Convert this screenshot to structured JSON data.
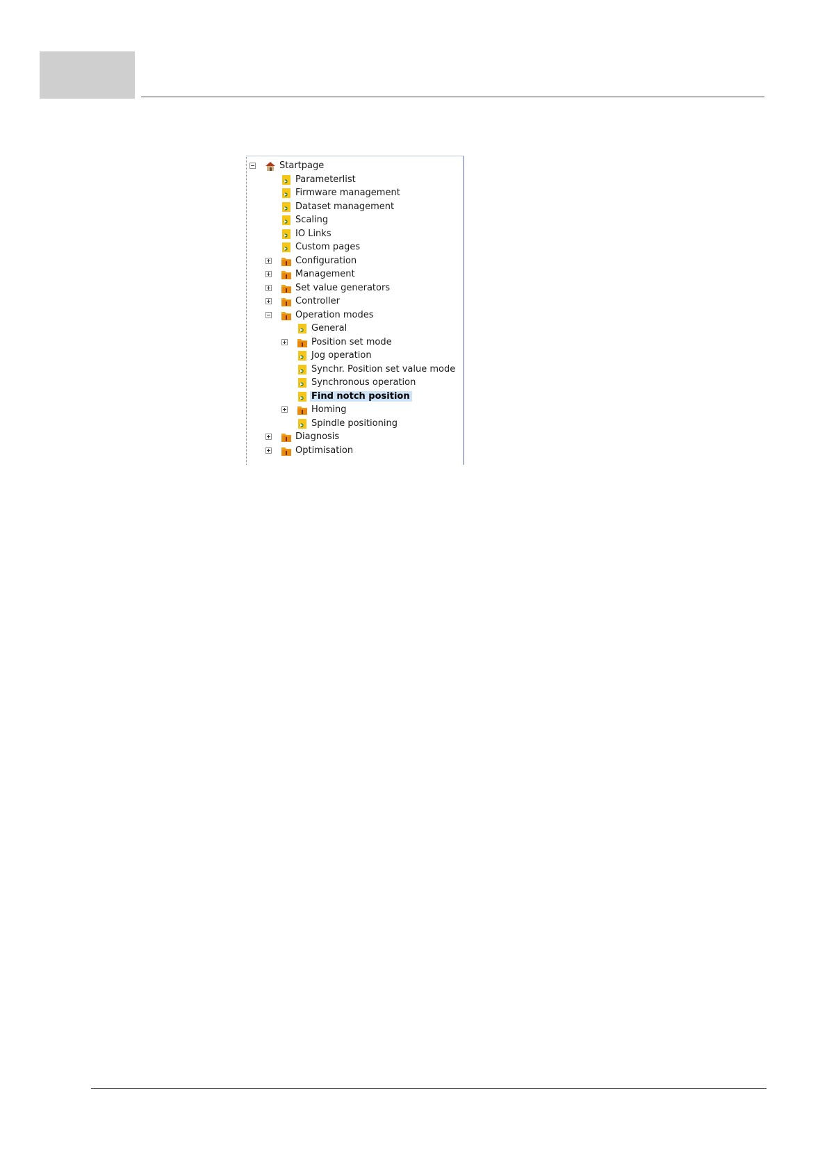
{
  "tree": {
    "root": {
      "label": "Startpage",
      "icon": "house-icon",
      "expanded": true
    },
    "items": [
      {
        "label": "Parameterlist",
        "icon": "page-icon",
        "level": 1,
        "toggle": "none"
      },
      {
        "label": "Firmware management",
        "icon": "page-icon",
        "level": 1,
        "toggle": "none"
      },
      {
        "label": "Dataset management",
        "icon": "page-icon",
        "level": 1,
        "toggle": "none"
      },
      {
        "label": "Scaling",
        "icon": "page-icon",
        "level": 1,
        "toggle": "none"
      },
      {
        "label": "IO Links",
        "icon": "page-icon",
        "level": 1,
        "toggle": "none"
      },
      {
        "label": "Custom pages",
        "icon": "page-icon",
        "level": 1,
        "toggle": "none"
      },
      {
        "label": "Configuration",
        "icon": "folder-icon",
        "level": 1,
        "toggle": "plus"
      },
      {
        "label": "Management",
        "icon": "folder-icon",
        "level": 1,
        "toggle": "plus"
      },
      {
        "label": "Set value generators",
        "icon": "folder-icon",
        "level": 1,
        "toggle": "plus"
      },
      {
        "label": "Controller",
        "icon": "folder-icon",
        "level": 1,
        "toggle": "plus"
      },
      {
        "label": "Operation modes",
        "icon": "folder-icon",
        "level": 1,
        "toggle": "minus"
      },
      {
        "label": "General",
        "icon": "page-icon",
        "level": 2,
        "toggle": "none"
      },
      {
        "label": "Position set mode",
        "icon": "folder-icon",
        "level": 2,
        "toggle": "plus"
      },
      {
        "label": "Jog operation",
        "icon": "page-icon",
        "level": 2,
        "toggle": "none"
      },
      {
        "label": "Synchr. Position set value mode",
        "icon": "page-icon",
        "level": 2,
        "toggle": "none"
      },
      {
        "label": "Synchronous operation",
        "icon": "page-icon",
        "level": 2,
        "toggle": "none"
      },
      {
        "label": "Find notch position",
        "icon": "page-icon",
        "level": 2,
        "toggle": "none",
        "selected": true
      },
      {
        "label": "Homing",
        "icon": "folder-icon",
        "level": 2,
        "toggle": "plus"
      },
      {
        "label": "Spindle positioning",
        "icon": "page-icon",
        "level": 2,
        "toggle": "none"
      },
      {
        "label": "Diagnosis",
        "icon": "folder-icon",
        "level": 1,
        "toggle": "plus"
      },
      {
        "label": "Optimisation",
        "icon": "folder-icon",
        "level": 1,
        "toggle": "plus"
      }
    ]
  },
  "colors": {
    "selection": "#cfe3f6",
    "folder": "#f0a31c",
    "page": "#f5c518"
  }
}
